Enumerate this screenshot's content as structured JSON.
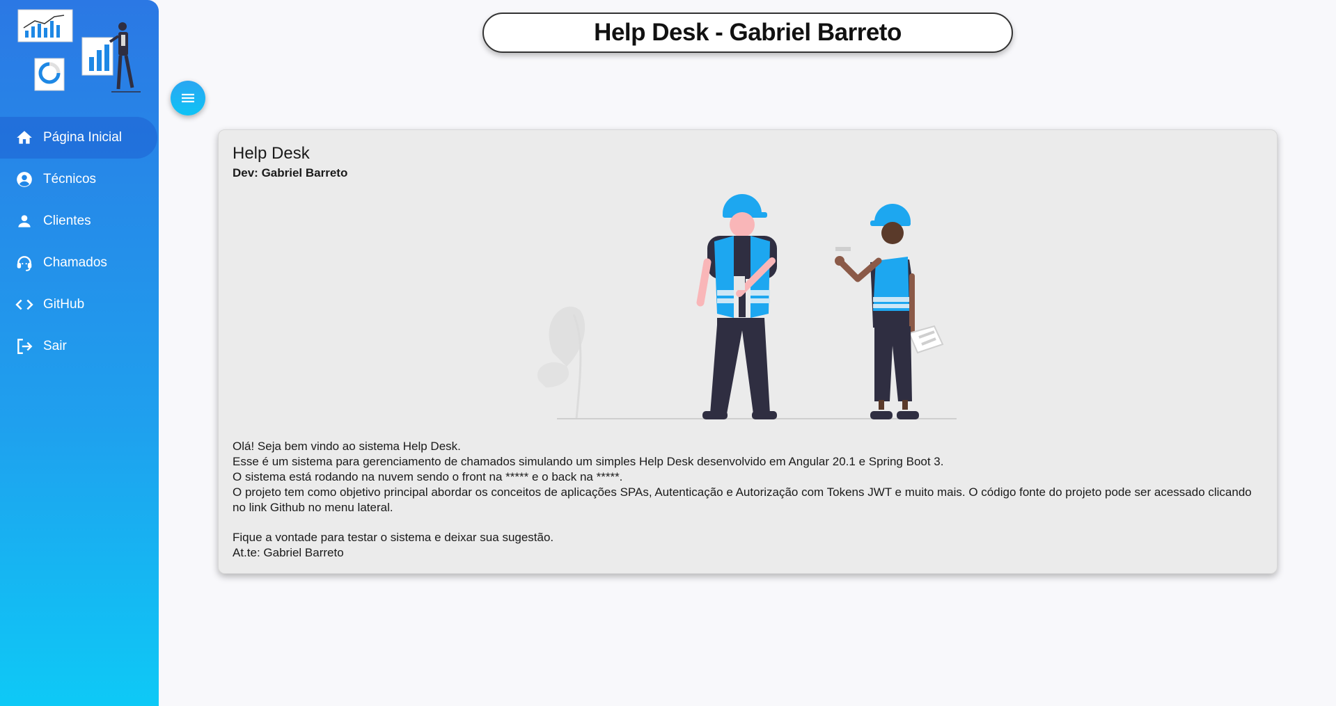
{
  "header": {
    "title": "Help Desk - Gabriel Barreto"
  },
  "sidebar": {
    "items": [
      {
        "label": "Página Inicial",
        "icon": "home-icon",
        "active": true
      },
      {
        "label": "Técnicos",
        "icon": "account-circle-icon",
        "active": false
      },
      {
        "label": "Clientes",
        "icon": "person-icon",
        "active": false
      },
      {
        "label": "Chamados",
        "icon": "headset-icon",
        "active": false
      },
      {
        "label": "GitHub",
        "icon": "code-icon",
        "active": false
      },
      {
        "label": "Sair",
        "icon": "logout-icon",
        "active": false
      }
    ]
  },
  "menu_button": {
    "icon": "hamburger-menu-icon"
  },
  "card": {
    "title": "Help Desk",
    "subtitle": "Dev: Gabriel Barreto",
    "paragraphs": [
      "Olá! Seja bem vindo ao sistema Help Desk.",
      "Esse é um sistema para gerenciamento de chamados simulando um simples Help Desk desenvolvido em Angular 20.1 e Spring Boot 3.",
      "O sistema está rodando na nuvem sendo o front na ***** e o back na *****.",
      "O projeto tem como objetivo principal abordar os conceitos de aplicações SPAs, Autenticação e Autorização com Tokens JWT e muito mais. O código fonte do projeto pode ser acessado clicando no link Github no menu lateral."
    ],
    "closing": [
      "Fique a vontade para testar o sistema e deixar sua sugestão.",
      "At.te: Gabriel Barreto"
    ]
  },
  "colors": {
    "sidebar_top": "#2b78e4",
    "sidebar_bottom": "#0ec9f6",
    "accent_helmet": "#1da7f0",
    "card_bg": "#ebebeb"
  }
}
